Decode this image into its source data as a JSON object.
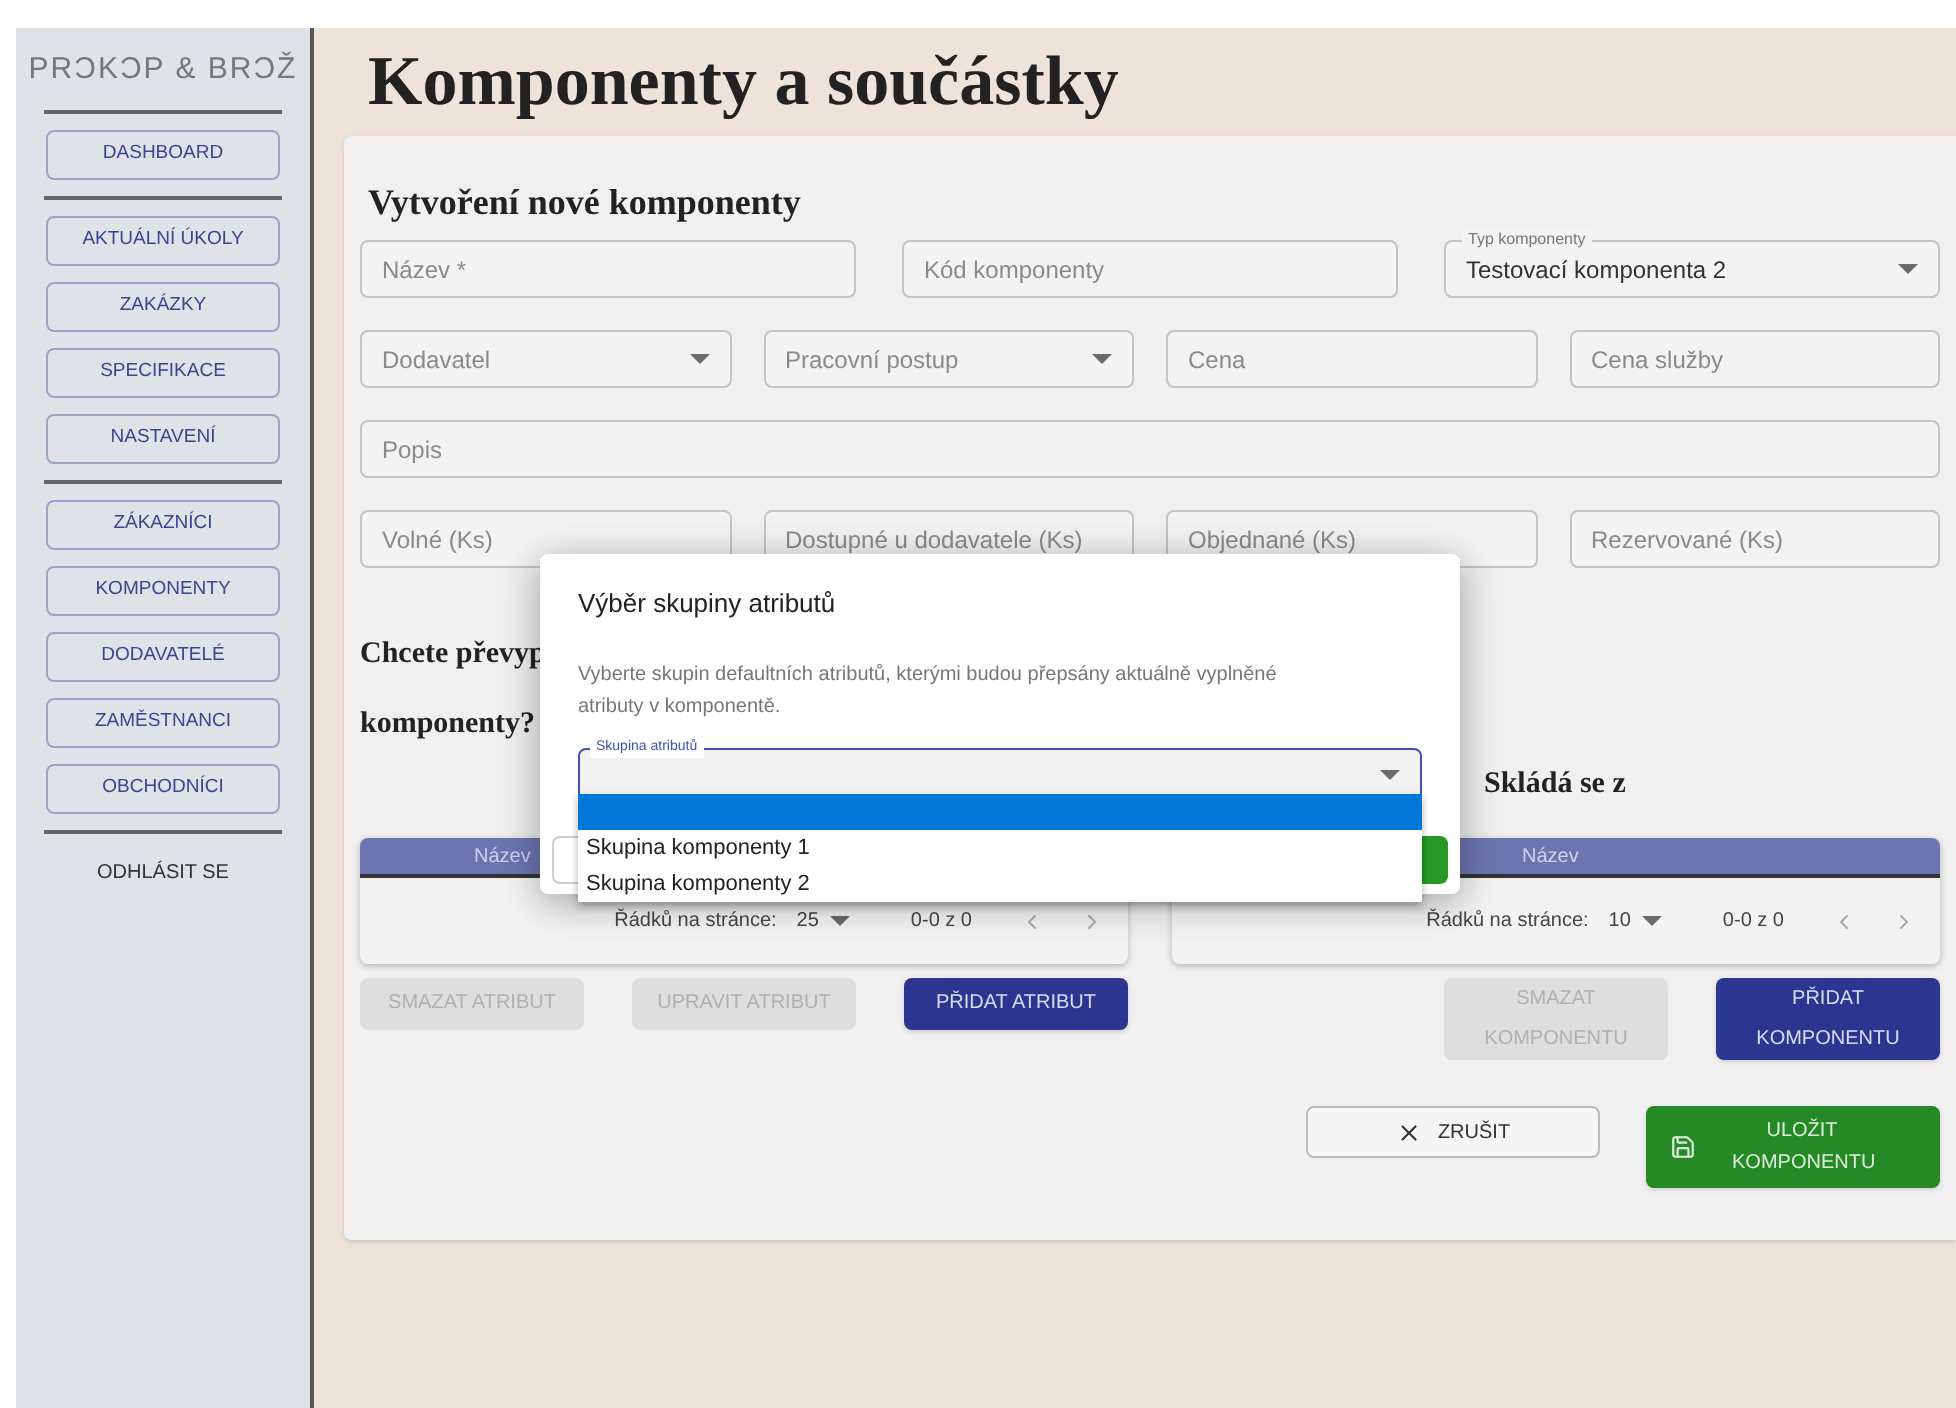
{
  "sidebar": {
    "logo": "PRƆKƆP & BRƆŽ",
    "groups": [
      [
        "DASHBOARD"
      ],
      [
        "AKTUÁLNÍ ÚKOLY",
        "ZAKÁZKY",
        "SPECIFIKACE",
        "NASTAVENÍ"
      ],
      [
        "ZÁKAZNÍCI",
        "KOMPONENTY",
        "DODAVATELÉ",
        "ZAMĚSTNANCI",
        "OBCHODNÍCI"
      ]
    ],
    "logout": "ODHLÁSIT SE"
  },
  "page_title": "Komponenty a součástky",
  "form": {
    "title": "Vytvoření nové komponenty",
    "identity": [
      {
        "kind": "text",
        "placeholder": "Název *"
      },
      {
        "kind": "text",
        "placeholder": "Kód komponenty"
      },
      {
        "kind": "select",
        "label": "Typ komponenty",
        "value": "Testovací komponenta 2"
      }
    ],
    "sourcing": [
      {
        "kind": "select",
        "placeholder": "Dodavatel"
      },
      {
        "kind": "select",
        "placeholder": "Pracovní postup"
      },
      {
        "kind": "text",
        "placeholder": "Cena"
      },
      {
        "kind": "text",
        "placeholder": "Cena služby"
      }
    ],
    "description": {
      "kind": "text",
      "placeholder": "Popis"
    },
    "stock": [
      {
        "kind": "text",
        "placeholder": "Volné (Ks)"
      },
      {
        "kind": "text",
        "placeholder": "Dostupné u dodavatele (Ks)"
      },
      {
        "kind": "text",
        "placeholder": "Objednané (Ks)"
      },
      {
        "kind": "text",
        "placeholder": "Rezervované (Ks)"
      }
    ]
  },
  "attributes": {
    "question": [
      "Chcete převyp",
      "komponenty?"
    ],
    "column": "Název",
    "rows_per_page_label": "Řádků na stránce:",
    "rows_per_page": "25",
    "range": "0-0 z 0",
    "buttons": [
      {
        "label": "SMAZAT ATRIBUT",
        "disabled": true
      },
      {
        "label": "UPRAVIT ATRIBUT",
        "disabled": true
      },
      {
        "label": "PŘIDAT ATRIBUT",
        "disabled": false
      }
    ]
  },
  "parts": {
    "title": "Skládá se z",
    "column": "Název",
    "rows_per_page_label": "Řádků na stránce:",
    "rows_per_page": "10",
    "range": "0-0 z 0",
    "buttons": [
      {
        "label": "SMAZAT KOMPONENTU",
        "disabled": true
      },
      {
        "label": "PŘIDAT KOMPONENTU",
        "disabled": false
      }
    ]
  },
  "actions": {
    "cancel": "ZRUŠIT",
    "save": "ULOŽIT KOMPONENTU"
  },
  "dialog": {
    "title": "Výběr skupiny atributů",
    "text": "Vyberte skupin defaultních atributů, kterými budou přepsány aktuálně vyplněné atributy v komponentě.",
    "field_label": "Skupina atributů",
    "options": [
      {
        "selected": true
      },
      {
        "label": "Skupina komponenty 1",
        "selected": false
      },
      {
        "label": "Skupina komponenty 2",
        "selected": false
      }
    ]
  }
}
